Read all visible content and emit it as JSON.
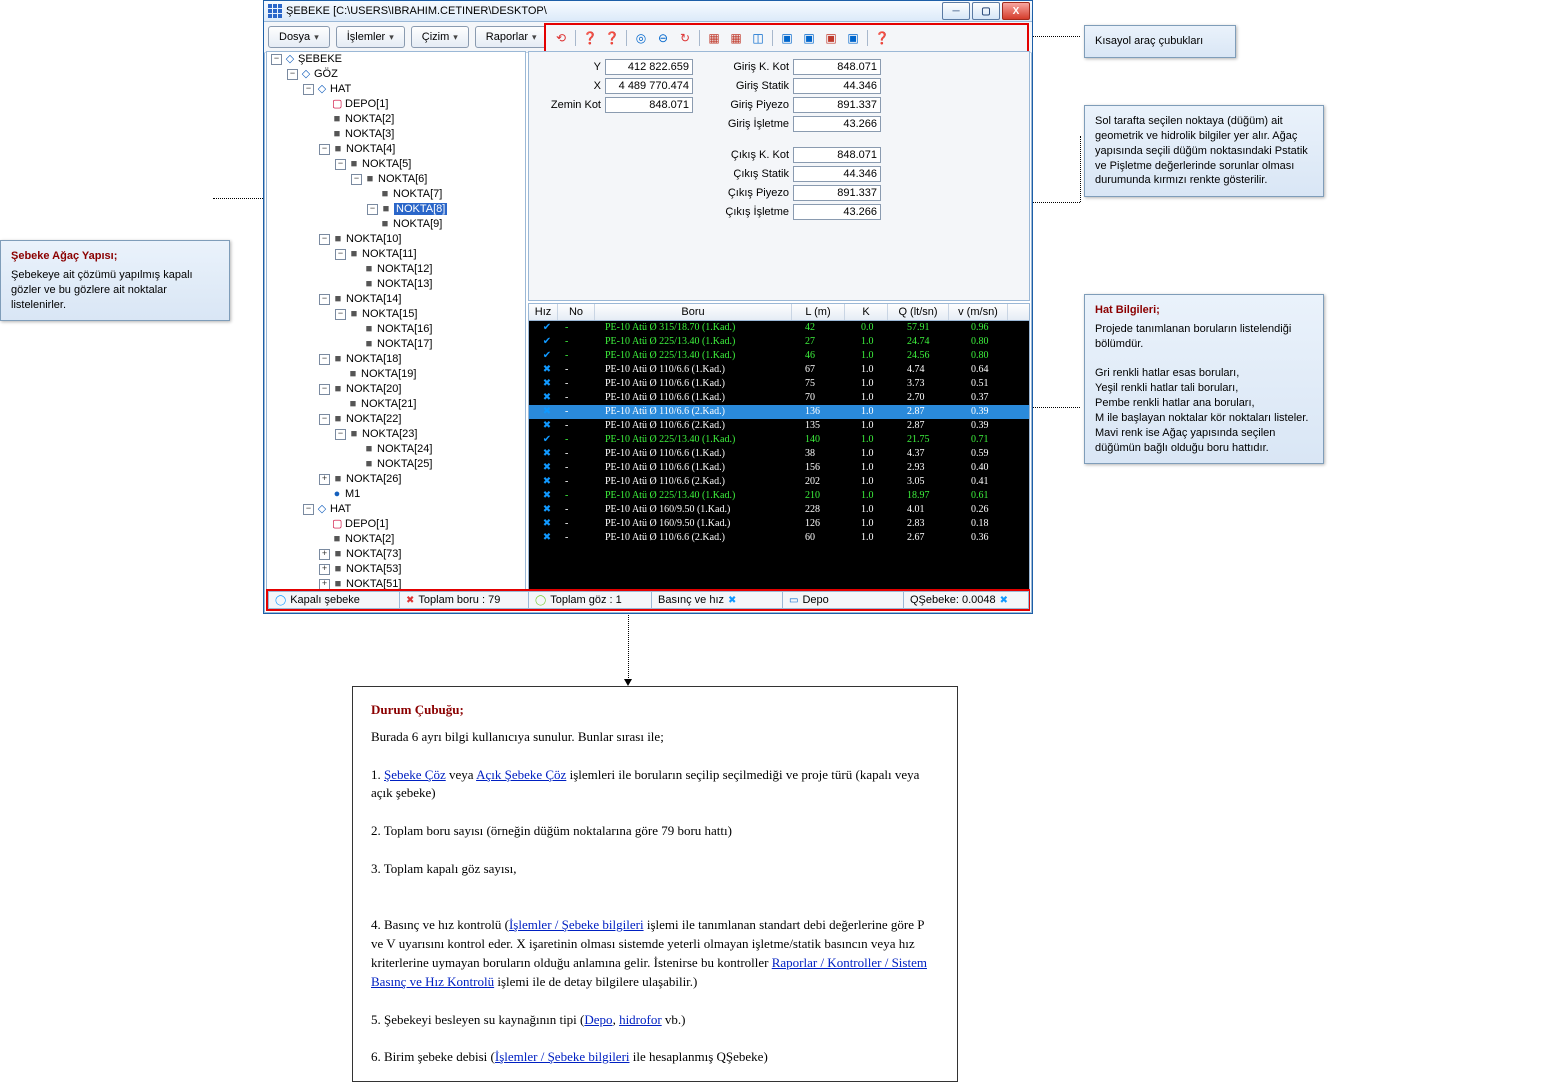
{
  "window": {
    "title": "ŞEBEKE [C:\\USERS\\IBRAHIM.CETINER\\DESKTOP\\"
  },
  "menu": [
    "Dosya",
    "İşlemler",
    "Çizim",
    "Raporlar"
  ],
  "callouts": {
    "tree": {
      "title": "Şebeke Ağaç Yapısı;",
      "body": "Şebekeye ait çözümü yapılmış kapalı gözler ve bu gözlere ait noktalar listelenirler."
    },
    "toolbar": {
      "body": "Kısayol araç çubukları"
    },
    "props": {
      "body": "Sol tarafta seçilen noktaya (düğüm) ait geometrik ve hidrolik bilgiler yer alır. Ağaç yapısında seçili düğüm noktasındaki Pstatik ve Pişletme değerlerinde sorunlar olması durumunda kırmızı renkte gösterilir."
    },
    "grid": {
      "title": "Hat Bilgileri;",
      "l1": "Projede tanımlanan boruların listelendiği bölümdür.",
      "l2": "Gri renkli hatlar esas boruları,",
      "l3": "Yeşil renkli hatlar tali boruları,",
      "l4": "Pembe renkli hatlar ana boruları,",
      "l5": "M ile başlayan noktalar kör noktaları listeler.",
      "l6": "Mavi renk ise Ağaç yapısında seçilen düğümün bağlı olduğu boru hattıdır."
    }
  },
  "propsLeft": [
    {
      "label": "Y",
      "value": "412 822.659"
    },
    {
      "label": "X",
      "value": "4 489 770.474"
    },
    {
      "label": "Zemin Kot",
      "value": "848.071"
    }
  ],
  "propsRight": [
    {
      "label": "Giriş K. Kot",
      "value": "848.071"
    },
    {
      "label": "Giriş Statik",
      "value": "44.346"
    },
    {
      "label": "Giriş Piyezo",
      "value": "891.337"
    },
    {
      "label": "Giriş İşletme",
      "value": "43.266"
    },
    {
      "label": "Çıkış K. Kot",
      "value": "848.071",
      "gap": true
    },
    {
      "label": "Çıkış Statik",
      "value": "44.346"
    },
    {
      "label": "Çıkış Piyezo",
      "value": "891.337"
    },
    {
      "label": "Çıkış İşletme",
      "value": "43.266"
    }
  ],
  "grid": {
    "headers": [
      "Hız",
      "No",
      "Boru",
      "L (m)",
      "K",
      "Q (lt/sn)",
      "v (m/sn)"
    ],
    "rows": [
      {
        "hiz": "✔",
        "hc": "#19f",
        "no": "-",
        "boru": "PE-10 Atü Ø 315/18.70  (1.Kad.)",
        "l": "42",
        "k": "0.0",
        "q": "57.91",
        "v": "0.96",
        "c": "g"
      },
      {
        "hiz": "✔",
        "hc": "#19f",
        "no": "-",
        "boru": "PE-10 Atü Ø 225/13.40  (1.Kad.)",
        "l": "27",
        "k": "1.0",
        "q": "24.74",
        "v": "0.80",
        "c": "g"
      },
      {
        "hiz": "✔",
        "hc": "#19f",
        "no": "-",
        "boru": "PE-10 Atü Ø 225/13.40  (1.Kad.)",
        "l": "46",
        "k": "1.0",
        "q": "24.56",
        "v": "0.80",
        "c": "g"
      },
      {
        "hiz": "✖",
        "hc": "#19f",
        "no": "-",
        "boru": "PE-10 Atü Ø 110/6.6  (1.Kad.)",
        "l": "67",
        "k": "1.0",
        "q": "4.74",
        "v": "0.64",
        "c": "w"
      },
      {
        "hiz": "✖",
        "hc": "#19f",
        "no": "-",
        "boru": "PE-10 Atü Ø 110/6.6  (1.Kad.)",
        "l": "75",
        "k": "1.0",
        "q": "3.73",
        "v": "0.51",
        "c": "w"
      },
      {
        "hiz": "✖",
        "hc": "#19f",
        "no": "-",
        "boru": "PE-10 Atü Ø 110/6.6  (1.Kad.)",
        "l": "70",
        "k": "1.0",
        "q": "2.70",
        "v": "0.37",
        "c": "w"
      },
      {
        "hiz": "✖",
        "hc": "#19f",
        "no": "-",
        "boru": "PE-10 Atü Ø 110/6.6  (2.Kad.)",
        "l": "136",
        "k": "1.0",
        "q": "2.87",
        "v": "0.39",
        "c": "w",
        "sel": true
      },
      {
        "hiz": "✖",
        "hc": "#19f",
        "no": "-",
        "boru": "PE-10 Atü Ø 110/6.6  (2.Kad.)",
        "l": "135",
        "k": "1.0",
        "q": "2.87",
        "v": "0.39",
        "c": "w"
      },
      {
        "hiz": "✔",
        "hc": "#19f",
        "no": "-",
        "boru": "PE-10 Atü Ø 225/13.40  (1.Kad.)",
        "l": "140",
        "k": "1.0",
        "q": "21.75",
        "v": "0.71",
        "c": "g"
      },
      {
        "hiz": "✖",
        "hc": "#19f",
        "no": "-",
        "boru": "PE-10 Atü Ø 110/6.6  (1.Kad.)",
        "l": "38",
        "k": "1.0",
        "q": "4.37",
        "v": "0.59",
        "c": "w"
      },
      {
        "hiz": "✖",
        "hc": "#19f",
        "no": "-",
        "boru": "PE-10 Atü Ø 110/6.6  (1.Kad.)",
        "l": "156",
        "k": "1.0",
        "q": "2.93",
        "v": "0.40",
        "c": "w"
      },
      {
        "hiz": "✖",
        "hc": "#19f",
        "no": "-",
        "boru": "PE-10 Atü Ø 110/6.6  (2.Kad.)",
        "l": "202",
        "k": "1.0",
        "q": "3.05",
        "v": "0.41",
        "c": "w"
      },
      {
        "hiz": "✖",
        "hc": "#19f",
        "no": "-",
        "boru": "PE-10 Atü Ø 225/13.40  (1.Kad.)",
        "l": "210",
        "k": "1.0",
        "q": "18.97",
        "v": "0.61",
        "c": "g"
      },
      {
        "hiz": "✖",
        "hc": "#19f",
        "no": "-",
        "boru": "PE-10 Atü Ø 160/9.50  (1.Kad.)",
        "l": "228",
        "k": "1.0",
        "q": "4.01",
        "v": "0.26",
        "c": "w"
      },
      {
        "hiz": "✖",
        "hc": "#19f",
        "no": "-",
        "boru": "PE-10 Atü Ø 160/9.50  (1.Kad.)",
        "l": "126",
        "k": "1.0",
        "q": "2.83",
        "v": "0.18",
        "c": "w"
      },
      {
        "hiz": "✖",
        "hc": "#19f",
        "no": "-",
        "boru": "PE-10 Atü Ø 110/6.6  (2.Kad.)",
        "l": "60",
        "k": "1.0",
        "q": "2.67",
        "v": "0.36",
        "c": "w"
      }
    ]
  },
  "status": [
    "Kapalı şebeke",
    "Toplam boru : 79",
    "Toplam göz : 1",
    "Basınç ve hız",
    "Depo",
    "QŞebeke: 0.0048"
  ],
  "statusDoc": {
    "title": "Durum Çubuğu;",
    "intro": "Burada 6 ayrı bilgi kullanıcıya sunulur. Bunlar sırası ile;",
    "l1a": "Şebeke Çöz",
    "l1b": "Açık Şebeke Çöz",
    "l1c": "işlemleri ile boruların seçilip seçilmediği ve proje türü (kapalı veya açık şebeke)",
    "l2": "2. Toplam boru sayısı (örneğin düğüm noktalarına göre 79 boru hattı)",
    "l3": "3. Toplam kapalı göz sayısı,",
    "l4a": "Basınç ve hız kontrolü",
    "l4link1": "İşlemler / Şebeke bilgileri",
    "l4b": "işlemi ile tanımlanan standart debi değerlerine göre P ve V uyarısını kontrol eder. X işaretinin olması sistemde yeterli olmayan işletme/statik basıncın veya hız kriterlerine uymayan boruların olduğu anlamına gelir. İstenirse bu kontroller",
    "l4link2": "Raporlar / Kontroller / Sistem Basınç ve Hız Kontrolü",
    "l4c": "işlemi ile de detay bilgilere ulaşabilir.)",
    "l5a": "Şebekeyi besleyen su kaynağının tipi",
    "l5link1": "Depo",
    "l5link2": "hidrofor",
    "l5b": "vb.)",
    "l6a": "Birim şebeke debisi",
    "l6link": "İşlemler / Şebeke bilgileri",
    "l6b": "ile hesaplanmış QŞebeke)"
  },
  "tree": [
    {
      "tw": "-",
      "ic": "d",
      "label": "ŞEBEKE",
      "children": [
        {
          "tw": "-",
          "ic": "d",
          "label": "GÖZ",
          "children": [
            {
              "tw": "-",
              "ic": "d",
              "label": "HAT",
              "children": [
                {
                  "ic": "dp",
                  "label": "DEPO[1]"
                },
                {
                  "ic": "sq",
                  "label": "NOKTA[2]"
                },
                {
                  "ic": "sq",
                  "label": "NOKTA[3]"
                },
                {
                  "tw": "-",
                  "ic": "sq",
                  "label": "NOKTA[4]",
                  "children": [
                    {
                      "tw": "-",
                      "ic": "sq",
                      "label": "NOKTA[5]",
                      "children": [
                        {
                          "tw": "-",
                          "ic": "sq",
                          "label": "NOKTA[6]",
                          "children": [
                            {
                              "ic": "sq",
                              "label": "NOKTA[7]"
                            },
                            {
                              "tw": "-",
                              "ic": "sq",
                              "label": "NOKTA[8]",
                              "sel": true
                            },
                            {
                              "ic": "sq",
                              "label": "NOKTA[9]"
                            }
                          ]
                        }
                      ]
                    }
                  ]
                },
                {
                  "tw": "-",
                  "ic": "sq",
                  "label": "NOKTA[10]",
                  "children": [
                    {
                      "tw": "-",
                      "ic": "sq",
                      "label": "NOKTA[11]",
                      "children": [
                        {
                          "ic": "sq",
                          "label": "NOKTA[12]"
                        },
                        {
                          "ic": "sq",
                          "label": "NOKTA[13]"
                        }
                      ]
                    }
                  ]
                },
                {
                  "tw": "-",
                  "ic": "sq",
                  "label": "NOKTA[14]",
                  "children": [
                    {
                      "tw": "-",
                      "ic": "sq",
                      "label": "NOKTA[15]",
                      "children": [
                        {
                          "ic": "sq",
                          "label": "NOKTA[16]"
                        },
                        {
                          "ic": "sq",
                          "label": "NOKTA[17]"
                        }
                      ]
                    }
                  ]
                },
                {
                  "tw": "-",
                  "ic": "sq",
                  "label": "NOKTA[18]",
                  "children": [
                    {
                      "ic": "sq",
                      "label": "NOKTA[19]"
                    }
                  ]
                },
                {
                  "tw": "-",
                  "ic": "sq",
                  "label": "NOKTA[20]",
                  "children": [
                    {
                      "ic": "sq",
                      "label": "NOKTA[21]"
                    }
                  ]
                },
                {
                  "tw": "-",
                  "ic": "sq",
                  "label": "NOKTA[22]",
                  "children": [
                    {
                      "tw": "-",
                      "ic": "sq",
                      "label": "NOKTA[23]",
                      "children": [
                        {
                          "ic": "sq",
                          "label": "NOKTA[24]"
                        },
                        {
                          "ic": "sq",
                          "label": "NOKTA[25]"
                        }
                      ]
                    }
                  ]
                },
                {
                  "tw": "+",
                  "ic": "sq",
                  "label": "NOKTA[26]"
                },
                {
                  "ic": "g",
                  "label": "M1",
                  "style": "color:#d33"
                }
              ]
            },
            {
              "tw": "-",
              "ic": "d",
              "label": "HAT",
              "children": [
                {
                  "ic": "dp",
                  "label": "DEPO[1]"
                },
                {
                  "ic": "sq",
                  "label": "NOKTA[2]"
                },
                {
                  "tw": "+",
                  "ic": "sq",
                  "label": "NOKTA[73]"
                },
                {
                  "tw": "+",
                  "ic": "sq",
                  "label": "NOKTA[53]"
                },
                {
                  "tw": "+",
                  "ic": "sq",
                  "label": "NOKTA[51]"
                }
              ]
            }
          ]
        }
      ]
    }
  ]
}
